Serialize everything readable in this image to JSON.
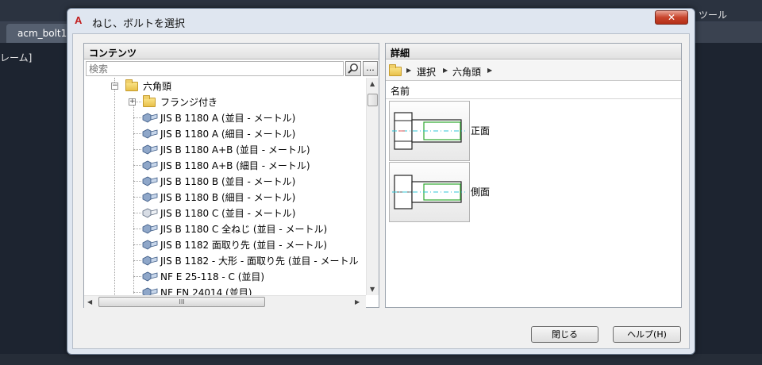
{
  "background": {
    "tab_label": "acm_bolt1",
    "side_text": "レーム]",
    "toolbar_text": "ツール"
  },
  "dialog": {
    "title": "ねじ、ボルトを選択",
    "close_label": "✕",
    "close_color": "#c8442c"
  },
  "left_panel": {
    "header": "コンテンツ",
    "search_placeholder": "検索",
    "more_label": "...",
    "hscroll_grip": "III",
    "tree": [
      {
        "label": "六角頭",
        "icon": "folder-icon",
        "expanded": true
      },
      {
        "label": "フランジ付き",
        "icon": "folder-icon",
        "expanded": false
      },
      {
        "label": "JIS B 1180  A  (並目 - メートル)",
        "icon": "bolt-icon"
      },
      {
        "label": "JIS B 1180  A  (細目 - メートル)",
        "icon": "bolt-icon"
      },
      {
        "label": "JIS B 1180  A+B  (並目 - メートル)",
        "icon": "bolt-icon"
      },
      {
        "label": "JIS B 1180  A+B  (細目 - メートル)",
        "icon": "bolt-icon"
      },
      {
        "label": "JIS B 1180  B  (並目 - メートル)",
        "icon": "bolt-icon"
      },
      {
        "label": "JIS B 1180  B  (細目 - メートル)",
        "icon": "bolt-icon"
      },
      {
        "label": "JIS B 1180  C  (並目 - メートル)",
        "icon": "bolt-icon"
      },
      {
        "label": "JIS B 1180  C  全ねじ  (並目 - メートル)",
        "icon": "bolt-icon"
      },
      {
        "label": "JIS B 1182  面取り先  (並目 - メートル)",
        "icon": "bolt-icon"
      },
      {
        "label": "JIS B 1182 - 大形 - 面取り先  (並目 - メートル",
        "icon": "bolt-icon"
      },
      {
        "label": "NF E 25-118 - C  (並目)",
        "icon": "bolt-icon"
      },
      {
        "label": "NF EN 24014  (並目)",
        "icon": "bolt-icon"
      }
    ]
  },
  "right_panel": {
    "header": "詳細",
    "breadcrumb": [
      "選択",
      "六角頭"
    ],
    "column_header": "名前",
    "views": [
      {
        "label": "正面"
      },
      {
        "label": "側面"
      }
    ]
  },
  "buttons": {
    "close": "閉じる",
    "help": "ヘルプ(H)"
  }
}
